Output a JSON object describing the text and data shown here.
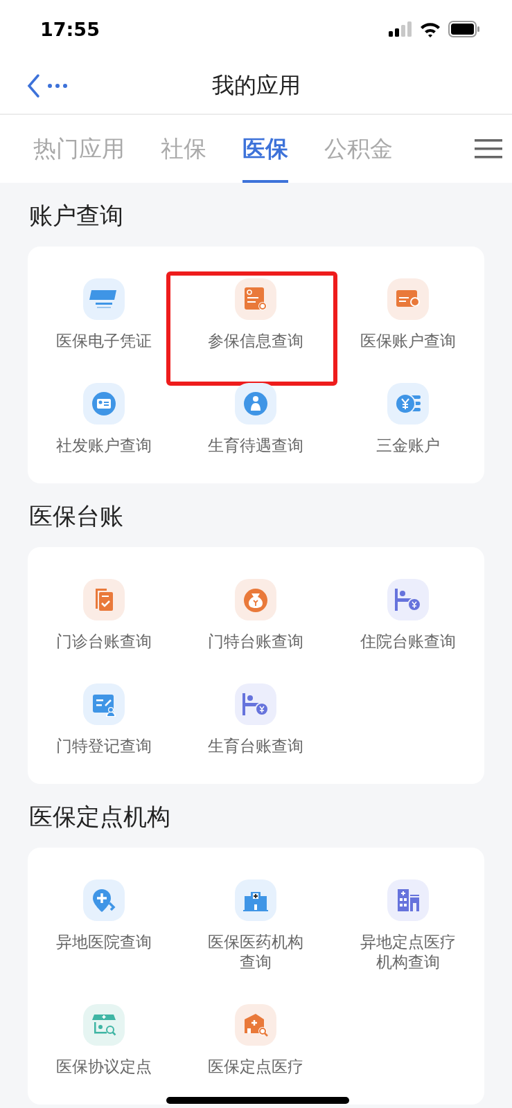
{
  "status_bar": {
    "time": "17:55"
  },
  "nav": {
    "title": "我的应用"
  },
  "tabs": [
    {
      "label": "热门应用",
      "selected": false
    },
    {
      "label": "社保",
      "selected": false
    },
    {
      "label": "医保",
      "selected": true
    },
    {
      "label": "公积金",
      "selected": false
    }
  ],
  "sections": [
    {
      "title": "账户查询",
      "items": [
        {
          "label": "医保电子凭证",
          "highlighted": false
        },
        {
          "label": "参保信息查询",
          "highlighted": true
        },
        {
          "label": "医保账户查询",
          "highlighted": false
        },
        {
          "label": "社发账户查询",
          "highlighted": false
        },
        {
          "label": "生育待遇查询",
          "highlighted": false
        },
        {
          "label": "三金账户",
          "highlighted": false
        }
      ]
    },
    {
      "title": "医保台账",
      "items": [
        {
          "label": "门诊台账查询",
          "highlighted": false
        },
        {
          "label": "门特台账查询",
          "highlighted": false
        },
        {
          "label": "住院台账查询",
          "highlighted": false
        },
        {
          "label": "门特登记查询",
          "highlighted": false
        },
        {
          "label": "生育台账查询",
          "highlighted": false
        }
      ]
    },
    {
      "title": "医保定点机构",
      "items": [
        {
          "label": "异地医院查询",
          "highlighted": false
        },
        {
          "label": "医保医药机构查询",
          "highlighted": false
        },
        {
          "label": "异地定点医疗机构查询",
          "highlighted": false
        },
        {
          "label": "医保协议定点",
          "highlighted": false
        },
        {
          "label": "医保定点医疗",
          "highlighted": false
        }
      ]
    }
  ]
}
